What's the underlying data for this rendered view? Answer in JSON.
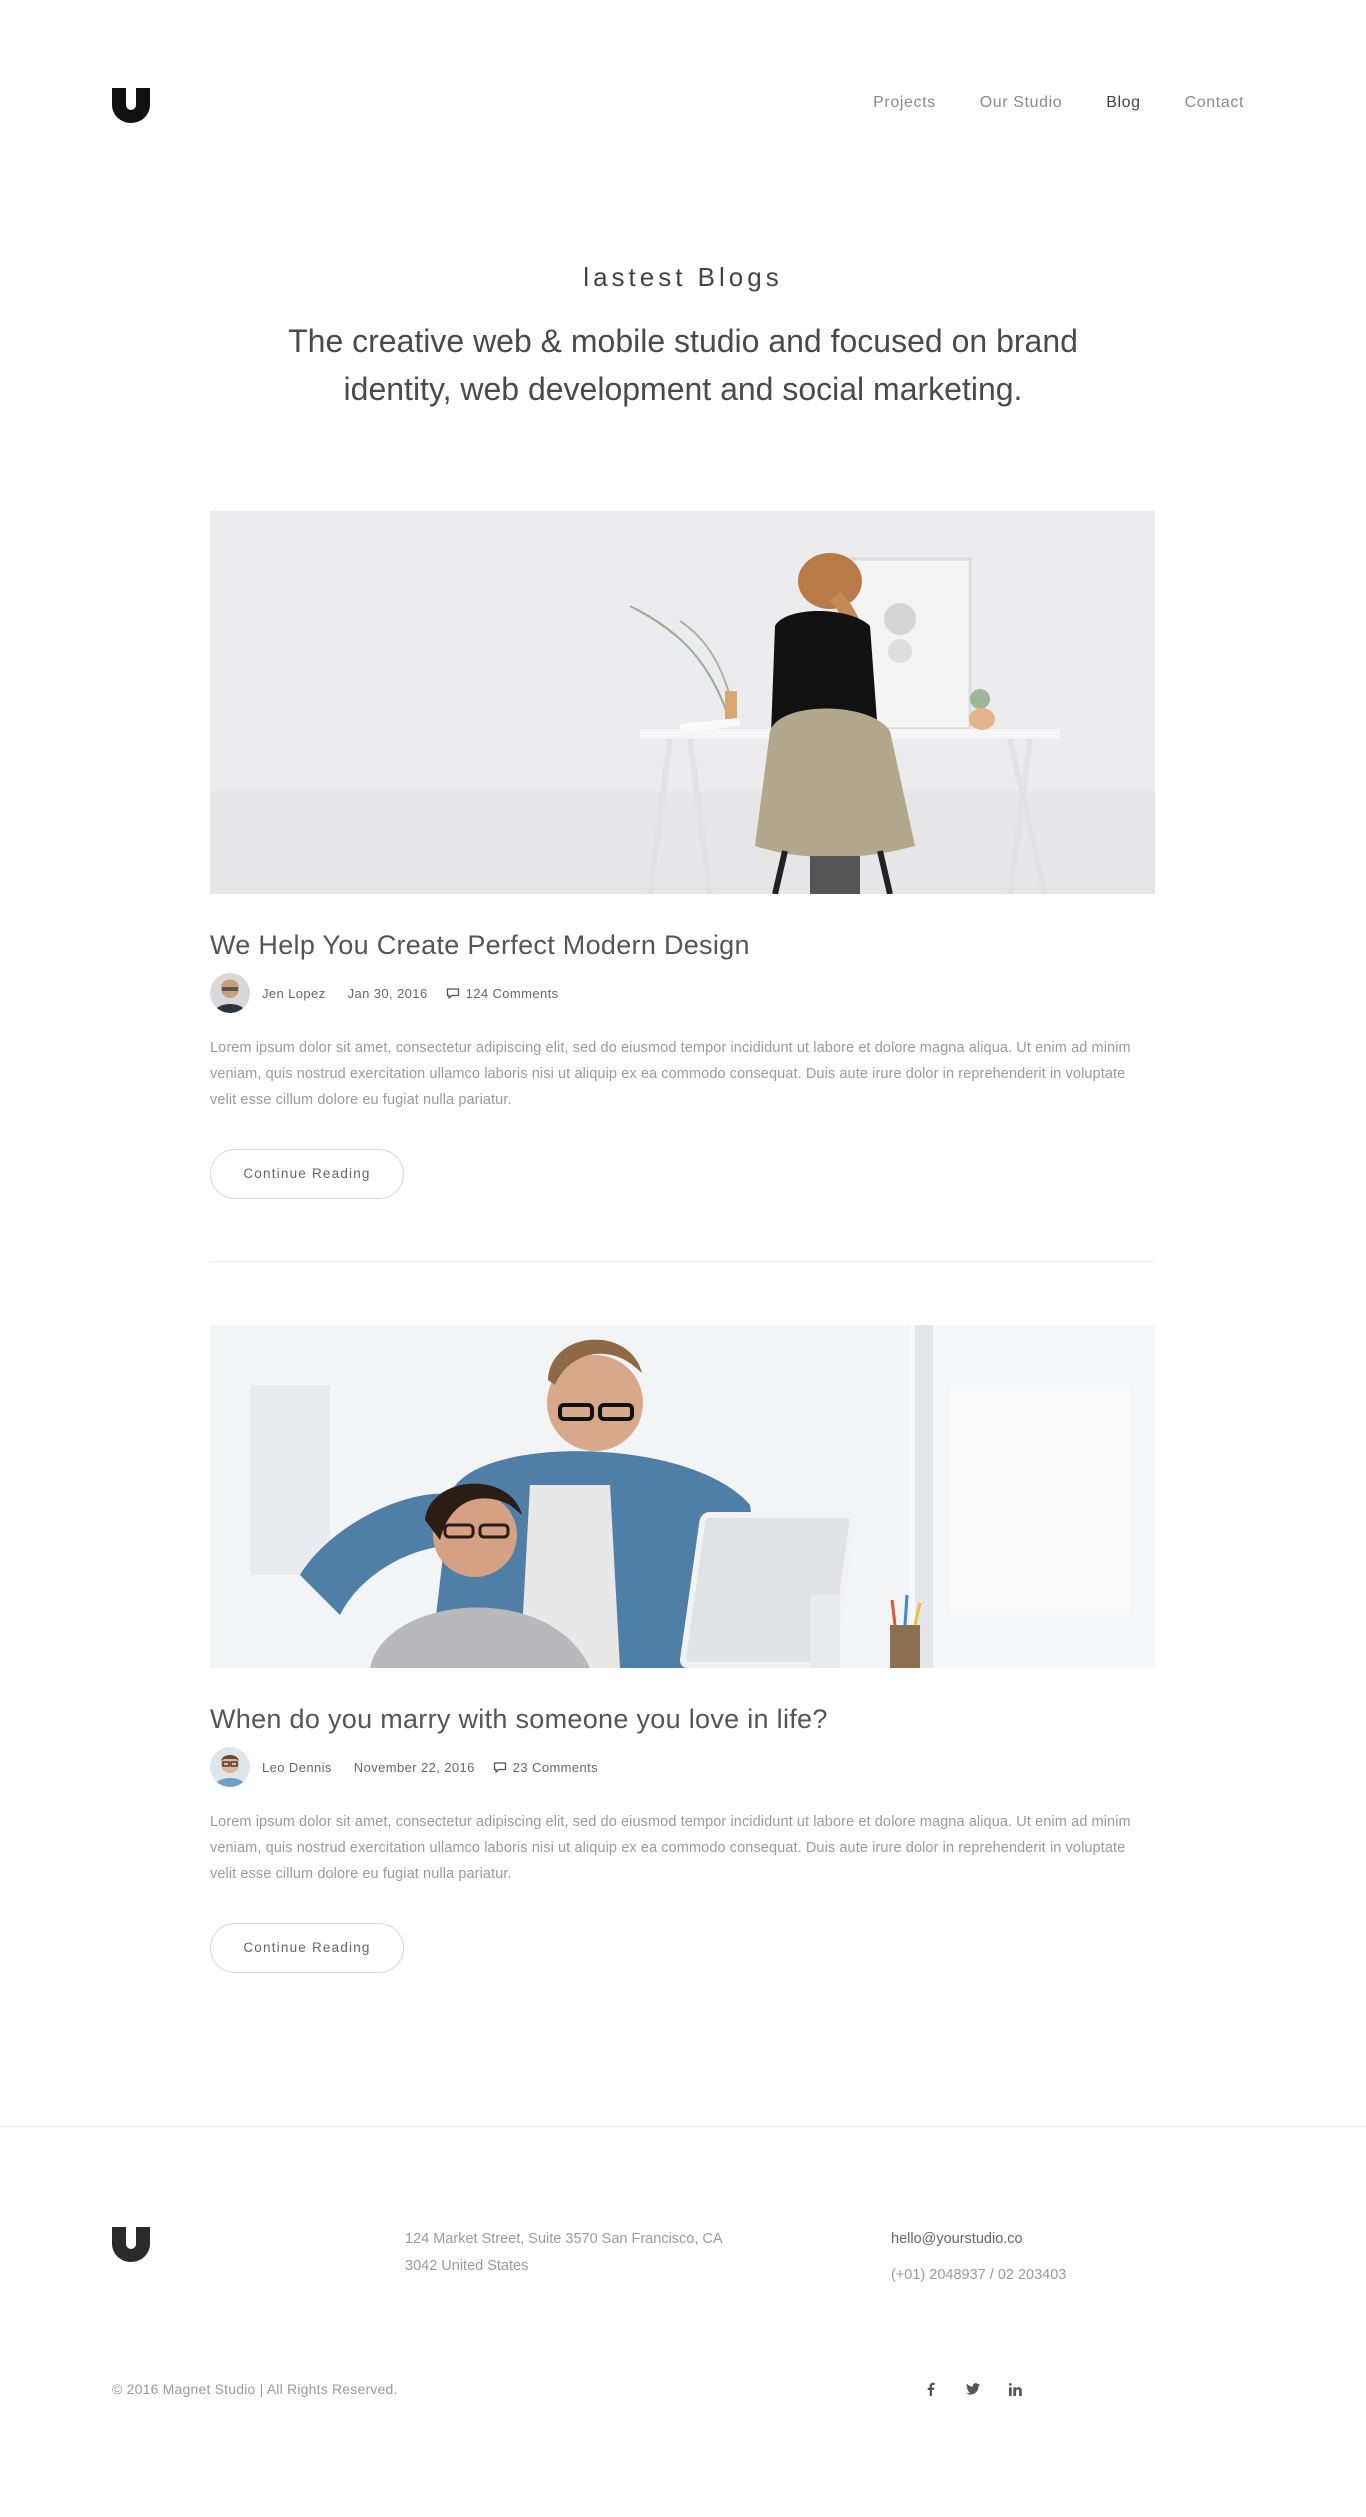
{
  "header": {
    "nav": [
      {
        "label": "Projects",
        "active": false
      },
      {
        "label": "Our Studio",
        "active": false
      },
      {
        "label": "Blog",
        "active": true
      },
      {
        "label": "Contact",
        "active": false
      }
    ]
  },
  "intro": {
    "kicker": "lastest Blogs",
    "lead": "The creative web & mobile studio and focused on brand identity, web development and social marketing."
  },
  "posts": [
    {
      "title": "We Help You Create Perfect Modern Design",
      "author": "Jen Lopez",
      "date": "Jan 30, 2016",
      "comments": "124 Comments",
      "excerpt": "Lorem ipsum dolor sit amet, consectetur adipiscing elit, sed do eiusmod tempor incididunt ut labore et dolore magna aliqua. Ut enim ad minim veniam, quis nostrud exercitation ullamco laboris nisi ut aliquip ex ea commodo consequat. Duis aute irure dolor in reprehenderit in voluptate velit esse cillum dolore eu fugiat nulla pariatur.",
      "button": "Continue Reading"
    },
    {
      "title": "When do you marry with someone you love in life?",
      "author": "Leo Dennis",
      "date": "November 22, 2016",
      "comments": "23 Comments",
      "excerpt": "Lorem ipsum dolor sit amet, consectetur adipiscing elit, sed do eiusmod tempor incididunt ut labore et dolore magna aliqua. Ut enim ad minim veniam, quis nostrud exercitation ullamco laboris nisi ut aliquip ex ea commodo consequat. Duis aute irure dolor in reprehenderit in voluptate velit esse cillum dolore eu fugiat nulla pariatur.",
      "button": "Continue Reading"
    }
  ],
  "footer": {
    "address_line1": "124 Market Street, Suite 3570 San Francisco, CA",
    "address_line2": "3042 United States",
    "email": "hello@yourstudio.co",
    "phone": "(+01) 2048937 / 02 203403",
    "copyright": "© 2016 Magnet Studio | All Rights Reserved.",
    "social": [
      "facebook-icon",
      "twitter-icon",
      "linkedin-icon"
    ]
  },
  "colors": {
    "text_dark": "#444444",
    "text_muted": "#9a9a9a",
    "border": "#d8d8d8"
  }
}
